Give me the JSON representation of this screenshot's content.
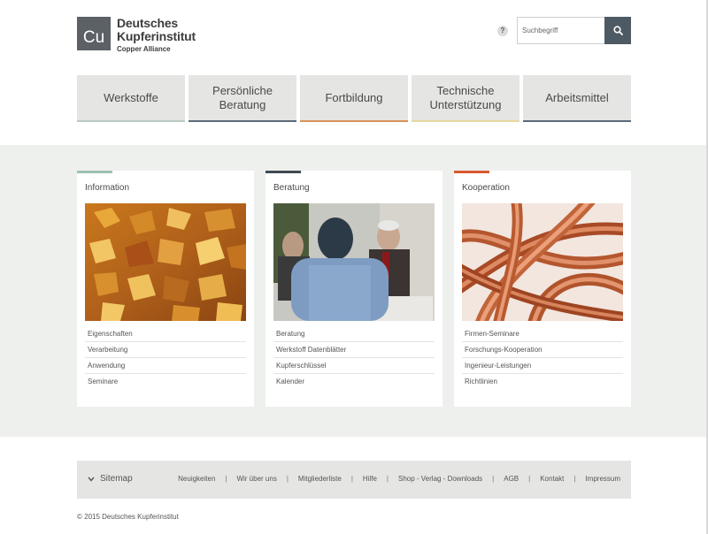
{
  "header": {
    "logo_mark": "Cu",
    "logo_line1": "Deutsches",
    "logo_line2": "Kupferinstitut",
    "logo_line3": "Copper Alliance",
    "help_label": "?",
    "search_placeholder": "Suchbegriff"
  },
  "nav": [
    {
      "label": "Werkstoffe",
      "accent": "#b8c9c4"
    },
    {
      "label": "Persönliche Beratung",
      "accent": "#5b6b7a"
    },
    {
      "label": "Fortbildung",
      "accent": "#d5935a"
    },
    {
      "label": "Technische Unterstützung",
      "accent": "#e8d9a0"
    },
    {
      "label": "Arbeitsmittel",
      "accent": "#5b6b7a"
    }
  ],
  "cards": [
    {
      "title": "Information",
      "accent": "#9cc2b2",
      "image": "copper-microstructure",
      "links": [
        "Eigenschaften",
        "Verarbeitung",
        "Anwendung",
        "Seminare"
      ]
    },
    {
      "title": "Beratung",
      "accent": "#3f4a52",
      "image": "consultation-meeting",
      "links": [
        "Beratung",
        "Werkstoff Datenblätter",
        "Kupferschlüssel",
        "Kalender"
      ]
    },
    {
      "title": "Kooperation",
      "accent": "#d85a2e",
      "image": "copper-wires",
      "links": [
        "Firmen-Seminare",
        "Forschungs-Kooperation",
        "Ingenieur-Leistungen",
        "Richtlinien"
      ]
    }
  ],
  "footer": {
    "sitemap_label": "Sitemap",
    "links": [
      "Neuigkeiten",
      "Wir über uns",
      "Mitgliederliste",
      "Hilfe",
      "Shop - Verlag - Downloads",
      "AGB",
      "Kontakt",
      "Impressum"
    ],
    "copyright": "© 2015 Deutsches Kupferinstitut"
  },
  "colors": {
    "search_button": "#4e5a63",
    "band_background": "#eef0ed",
    "nav_background": "#e5e5e3"
  }
}
